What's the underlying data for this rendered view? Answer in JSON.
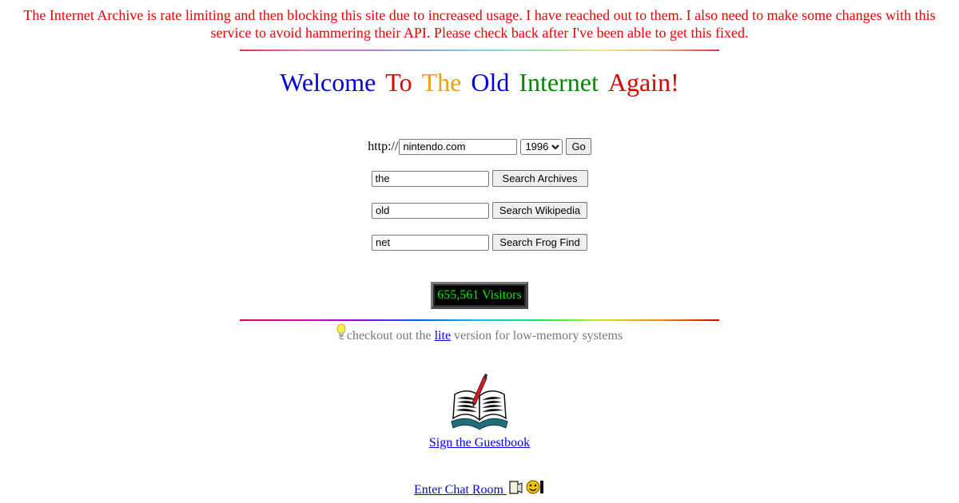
{
  "notice": {
    "text": "The Internet Archive is rate limiting and then blocking this site due to increased usage. I have reached out to them. I also need to make some changes with this service to avoid hammering their API. Please check back after I've been able to get this fixed.",
    "color": "#ee0000"
  },
  "welcome": {
    "words": [
      {
        "text": "Welcome",
        "color": "#0000dd"
      },
      {
        "text": "To",
        "color": "#dd0000"
      },
      {
        "text": "The",
        "color": "#f0a000"
      },
      {
        "text": "Old",
        "color": "#0000dd"
      },
      {
        "text": "Internet",
        "color": "#008800"
      },
      {
        "text": "Again!",
        "color": "#dd0000"
      }
    ]
  },
  "url_form": {
    "prefix": "http://",
    "url_value": "nintendo.com",
    "year_selected": "1996",
    "go_label": "Go"
  },
  "archives_form": {
    "query_value": "the",
    "button_label": "Search Archives"
  },
  "wikipedia_form": {
    "query_value": "old",
    "button_label": "Search Wikipedia"
  },
  "frogfind_form": {
    "query_value": "net",
    "button_label": "Search Frog Find"
  },
  "counter": {
    "text": "655,561 Visitors",
    "color": "#00ee00"
  },
  "lite": {
    "before": "checkout out the ",
    "link": "lite",
    "after": " version for low-memory systems",
    "icon": "lightbulb-icon"
  },
  "guestbook": {
    "link_label": "Sign the Guestbook",
    "icon": "open-book-with-pen-icon"
  },
  "chat": {
    "link_label": "Enter Chat Room ",
    "icon": "chat-smiley-phone-icon"
  },
  "colors": {
    "link": "#0000ee",
    "muted_text": "#777777",
    "counter_bg": "#000000"
  }
}
